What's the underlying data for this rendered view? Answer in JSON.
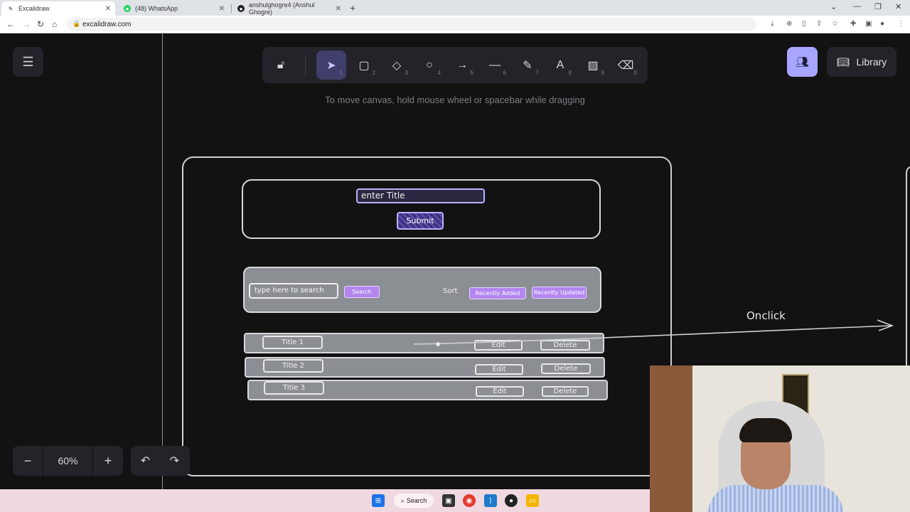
{
  "browser": {
    "tabs": [
      {
        "title": "Excalidraw",
        "active": true
      },
      {
        "title": "(48) WhatsApp",
        "active": false
      },
      {
        "title": "anshulghogre4 (Anshul Ghogre)",
        "active": false
      }
    ],
    "url": "excalidraw.com"
  },
  "toolbar": {
    "keys": [
      "1",
      "2",
      "3",
      "4",
      "5",
      "6",
      "7",
      "8",
      "9",
      "0"
    ]
  },
  "hint": "To move canvas, hold mouse wheel or spacebar while dragging",
  "library_label": "Library",
  "sketch": {
    "title_input": "enter Title",
    "submit": "Submit",
    "search_input": "type here to search",
    "search_btn": "Search",
    "sort_label": "Sort",
    "recently_added": "Recently Added",
    "recently_updated": "Recently Updated",
    "rows": [
      {
        "title": "Title 1",
        "edit": "Edit",
        "delete": "Delete"
      },
      {
        "title": "Title 2",
        "edit": "Edit",
        "delete": "Delete"
      },
      {
        "title": "Title 3",
        "edit": "Edit",
        "delete": "Delete"
      }
    ],
    "onclick_label": "Onclick"
  },
  "zoom": "60%",
  "taskbar": {
    "search_label": "Search"
  },
  "colors": {
    "accent": "#a8a5ff",
    "canvas": "#121212",
    "pill": "#b486f0"
  }
}
